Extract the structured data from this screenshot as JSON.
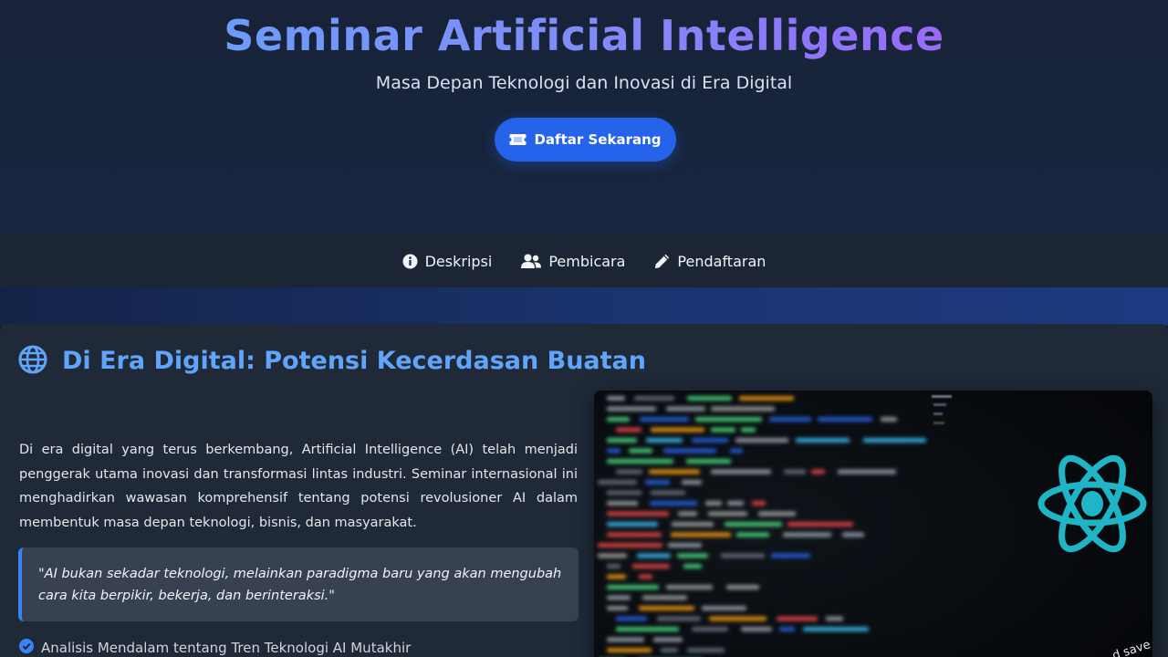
{
  "hero": {
    "title": "Seminar Artificial Intelligence",
    "subtitle": "Masa Depan Teknologi dan Inovasi di Era Digital",
    "cta_label": "Daftar Sekarang",
    "cta_icon": "ticket-icon"
  },
  "nav": {
    "items": [
      {
        "label": "Deskripsi",
        "icon": "info-circle-icon"
      },
      {
        "label": "Pembicara",
        "icon": "users-icon"
      },
      {
        "label": "Pendaftaran",
        "icon": "pencil-icon"
      }
    ]
  },
  "section": {
    "icon": "globe-icon",
    "title": "Di Era Digital: Potensi Kecerdasan Buatan",
    "description": "Di era digital yang terus berkembang, Artificial Intelligence (AI) telah menjadi penggerak utama inovasi dan transformasi lintas industri. Seminar internasional ini menghadirkan wawasan komprehensif tentang potensi revolusioner AI dalam membentuk masa depan teknologi, bisnis, dan masyarakat.",
    "quote": "\"AI bukan sekadar teknologi, melainkan paradigma baru yang akan mengubah cara kita berpikir, bekerja, dan berinteraksi.\"",
    "features": [
      {
        "icon": "check-circle-icon",
        "label": "Analisis Mendalam tentang Tren Teknologi AI Mutakhir"
      }
    ],
    "image": {
      "icon": "react-logo-icon",
      "caption": "d save to"
    }
  },
  "colors": {
    "accent": "#2563eb",
    "title_blue": "#60a5fa",
    "title_purple": "#a855f7",
    "card_bg": "#1f2937",
    "react_cyan": "#1fb5c6"
  }
}
